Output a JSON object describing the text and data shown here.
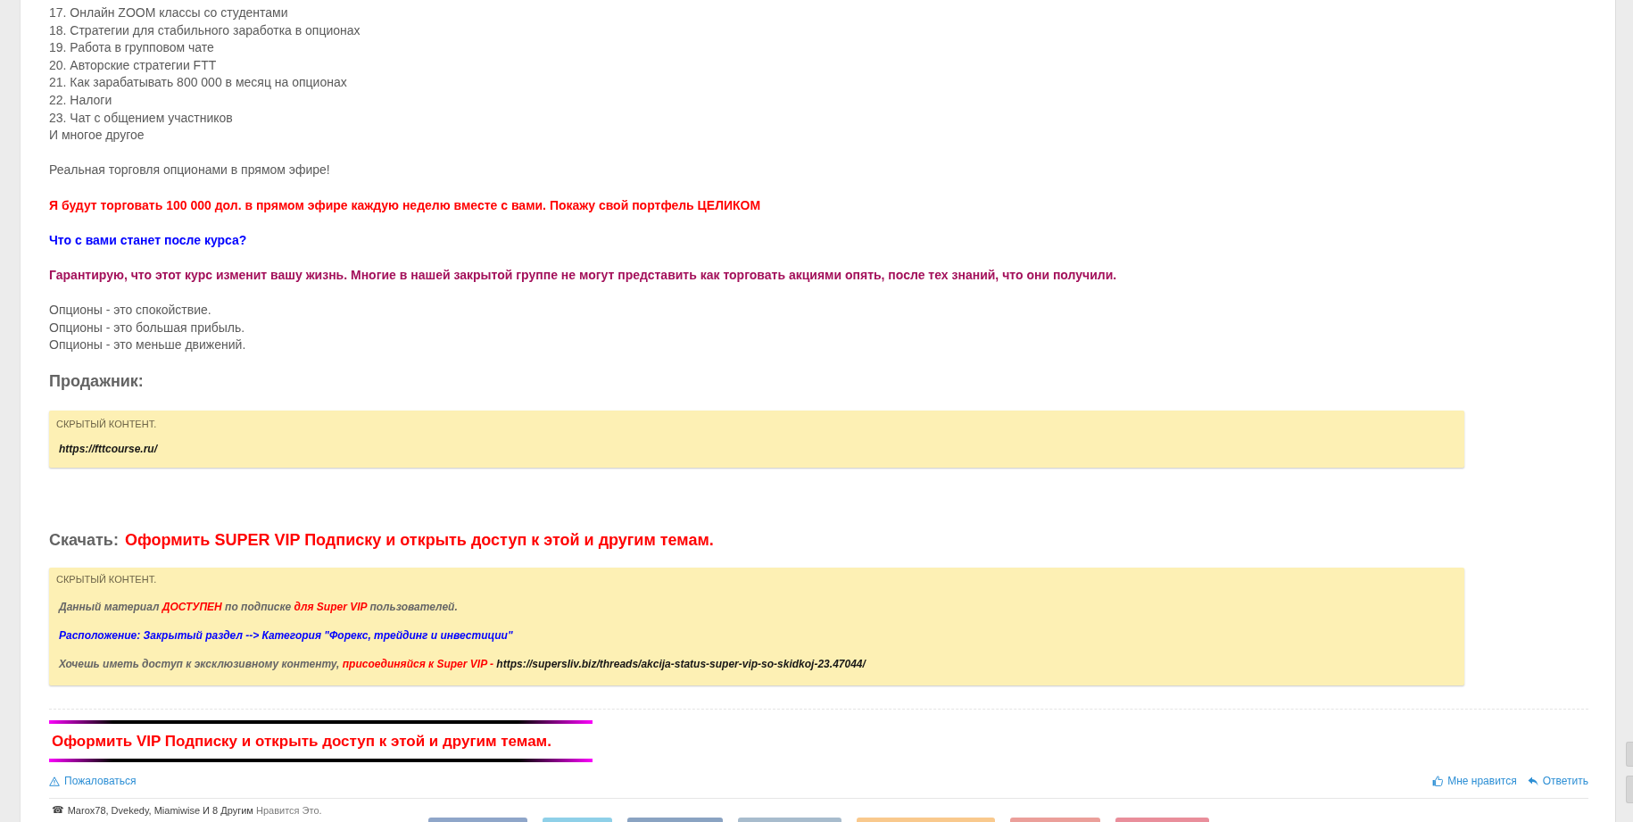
{
  "post": {
    "blocks": [
      {
        "kind": "plain",
        "lines": [
          "17. Онлайн ZOOM классы со студентами",
          "18. Стратегии для стабильного заработка в опционах",
          "19. Работа в групповом чате",
          "20. Авторские стратегии FTT",
          "21. Как зарабатывать 800 000 в месяц на опционах",
          "22. Налоги",
          "23. Чат с общением участников",
          "И многое другое"
        ]
      },
      {
        "kind": "plain",
        "lines": [
          "Реальная торговля опционами в прямом эфире!"
        ]
      },
      {
        "kind": "alert",
        "lines": [
          "Я будут торговать 100 000 дол. в прямом эфире каждую неделю вместе с вами. Покажу свой портфель ЦЕЛИКОМ"
        ]
      },
      {
        "kind": "question",
        "lines": [
          "Что с вами станет после курса?"
        ]
      },
      {
        "kind": "promise",
        "lines": [
          "Гарантирую, что этот курс изменит вашу жизнь. Многие в нашей закрытой группе не могут представить как торговать акциями опять, после тех знаний, что они получили."
        ]
      },
      {
        "kind": "plain",
        "lines": [
          "Опционы - это спокойствие.",
          "Опционы - это большая прибыль.",
          "Опционы - это меньше движений."
        ]
      }
    ]
  },
  "seller": {
    "heading": "Продажник:",
    "hidden_box": {
      "header": "СКРЫТЫЙ КОНТЕНТ.",
      "lines": [
        [
          {
            "kind": "link",
            "text": "https://fttcourse.ru/"
          }
        ]
      ]
    }
  },
  "download": {
    "label": "Скачать:",
    "link": "Оформить SUPER VIP Подписку и открыть доступ к этой и другим темам.",
    "hidden_box": {
      "header": "СКРЫТЫЙ КОНТЕНТ.",
      "lines": [
        [
          {
            "kind": "plain",
            "text": "Данный материал "
          },
          {
            "kind": "accent",
            "text": "ДОСТУПЕН"
          },
          {
            "kind": "plain",
            "text": " по подписке "
          },
          {
            "kind": "accent",
            "text": "для Super VIP"
          },
          {
            "kind": "plain",
            "text": " пользователей."
          }
        ],
        [
          {
            "kind": "info",
            "text": "Расположение: Закрытый раздел --> Категория \"Форекс, трейдинг и инвестиции\""
          }
        ],
        [
          {
            "kind": "plain",
            "text": "Хочешь иметь доступ к эксклюзивному контенту, "
          },
          {
            "kind": "accent",
            "text": "присоединяйся к Super VIP - "
          },
          {
            "kind": "link",
            "text": "https://supersliv.biz/threads/akcija-status-super-vip-so-skidkoj-23.47044/"
          }
        ]
      ]
    }
  },
  "banner": {
    "text": "Оформить VIP Подписку и открыть доступ к этой и другим темам."
  },
  "actions": {
    "report": "Пожаловаться",
    "like": "Мне нравится",
    "reply": "Ответить"
  },
  "likes": {
    "icon": "☎",
    "users": "Marox78, Dvekedy, Miamiwise И 8 Другим",
    "suffix": "Нравится Это."
  },
  "share_buttons": [
    {
      "color": "#8fa6c9"
    },
    {
      "color": "#8fd0e8"
    },
    {
      "color": "#8aa3c2"
    },
    {
      "color": "#a8bccd"
    },
    {
      "color": "#f9c98d"
    },
    {
      "color": "#eb9f9a"
    },
    {
      "color": "#e98e9b"
    }
  ]
}
